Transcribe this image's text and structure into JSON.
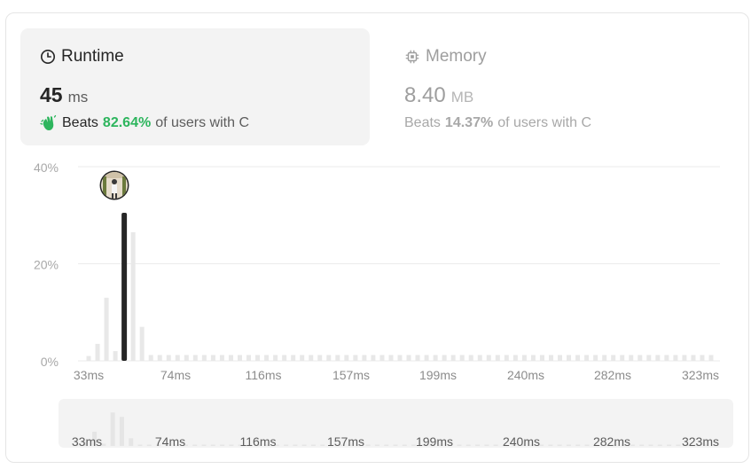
{
  "runtime": {
    "title": "Runtime",
    "value": "45",
    "unit": "ms",
    "beats_label": "Beats",
    "beats_pct": "82.64%",
    "beats_tail": "of users with C"
  },
  "memory": {
    "title": "Memory",
    "value": "8.40",
    "unit": "MB",
    "beats_label": "Beats",
    "beats_pct": "14.37%",
    "beats_tail": "of users with C"
  },
  "colors": {
    "accent_green": "#2db55d",
    "selected_bar": "#262626",
    "bar": "#e8e8e8"
  },
  "chart_data": {
    "type": "bar",
    "y_ticks": [
      "40%",
      "20%",
      "0%"
    ],
    "ylim": [
      0,
      40
    ],
    "x_tick_labels": [
      "33ms",
      "74ms",
      "116ms",
      "157ms",
      "199ms",
      "240ms",
      "282ms",
      "323ms"
    ],
    "values": [
      1,
      3.5,
      13,
      2,
      30.5,
      26.5,
      7,
      1.2,
      1.2,
      1.2,
      1.2,
      1.2,
      1.2,
      1.2,
      1.2,
      1.2,
      1.2,
      1.2,
      1.2,
      1.2,
      1.2,
      1.2,
      1.2,
      1.2,
      1.2,
      1.2,
      1.2,
      1.2,
      1.2,
      1.2,
      1.2,
      1.2,
      1.2,
      1.2,
      1.2,
      1.2,
      1.2,
      1.2,
      1.2,
      1.2,
      1.2,
      1.2,
      1.2,
      1.2,
      1.2,
      1.2,
      1.2,
      1.2,
      1.2,
      1.2,
      1.2,
      1.2,
      1.2,
      1.2,
      1.2,
      1.2,
      1.2,
      1.2,
      1.2,
      1.2,
      1.2,
      1.2,
      1.2,
      1.2,
      1.2,
      1.2,
      1.2,
      1.2,
      1.2,
      1.2,
      1.2
    ],
    "selected_index": 4,
    "grid": true
  },
  "overview_chart": {
    "x_tick_labels": [
      "33ms",
      "74ms",
      "116ms",
      "157ms",
      "199ms",
      "240ms",
      "282ms",
      "323ms"
    ]
  }
}
